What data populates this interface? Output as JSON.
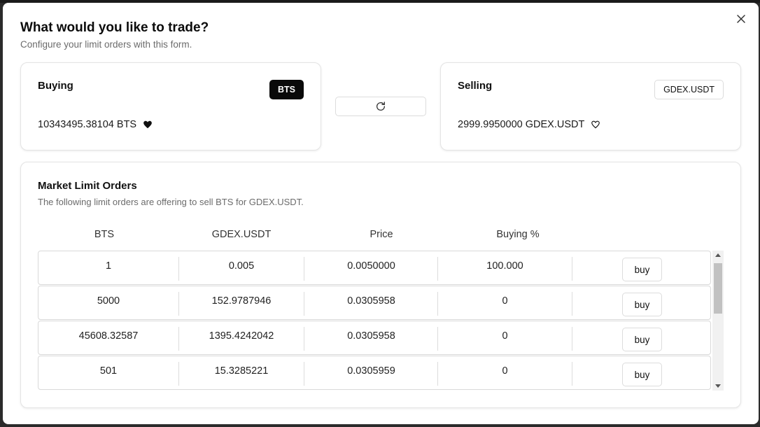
{
  "dialog": {
    "title": "What would you like to trade?",
    "subtitle": "Configure your limit orders with this form."
  },
  "buying": {
    "label": "Buying",
    "asset": "BTS",
    "balance": "10343495.38104 BTS",
    "favorite_icon": "heart-filled-icon"
  },
  "selling": {
    "label": "Selling",
    "asset": "GDEX.USDT",
    "balance": "2999.9950000 GDEX.USDT",
    "favorite_icon": "heart-outline-icon"
  },
  "swap": {
    "icon": "refresh-icon"
  },
  "market": {
    "title": "Market Limit Orders",
    "subtitle": "The following limit orders are offering to sell BTS for GDEX.USDT.",
    "columns": [
      "BTS",
      "GDEX.USDT",
      "Price",
      "Buying %"
    ],
    "buy_label": "buy",
    "rows": [
      {
        "bts": "1",
        "usdt": "0.005",
        "price": "0.0050000",
        "pct": "100.000"
      },
      {
        "bts": "5000",
        "usdt": "152.9787946",
        "price": "0.0305958",
        "pct": "0"
      },
      {
        "bts": "45608.32587",
        "usdt": "1395.4242042",
        "price": "0.0305958",
        "pct": "0"
      },
      {
        "bts": "501",
        "usdt": "15.3285221",
        "price": "0.0305959",
        "pct": "0"
      }
    ]
  },
  "colors": {
    "accent_dark": "#0a0a0a",
    "border": "#d9d9d9",
    "muted_text": "#6b6b6b"
  }
}
